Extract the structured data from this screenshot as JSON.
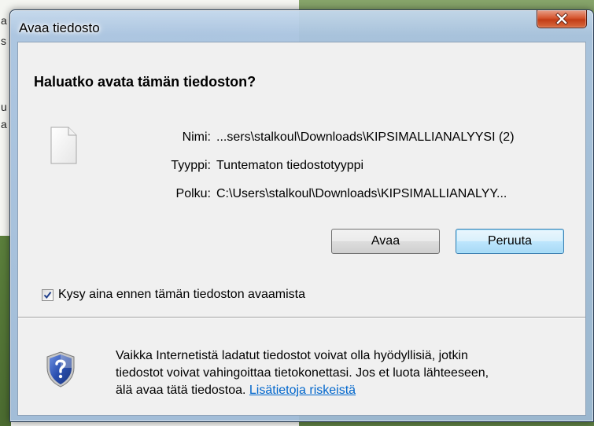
{
  "background": {
    "letters": [
      "a",
      "s",
      "u",
      "a"
    ]
  },
  "dialog": {
    "title": "Avaa tiedosto",
    "close_icon": "close-icon",
    "question": "Haluatko avata tämän tiedoston?",
    "file_icon": "blank-file-icon",
    "fields": [
      {
        "label": "Nimi:",
        "value": "...sers\\stalkoul\\Downloads\\KIPSIMALLIANALYYSI (2)"
      },
      {
        "label": "Tyyppi:",
        "value": "Tuntematon tiedostotyyppi"
      },
      {
        "label": "Polku:",
        "value": "C:\\Users\\stalkoul\\Downloads\\KIPSIMALLIANALYY..."
      }
    ],
    "buttons": {
      "open_label": "Avaa",
      "cancel_label": "Peruuta"
    },
    "checkbox": {
      "label": "Kysy aina ennen tämän tiedoston avaamista",
      "checked": true
    },
    "warning": {
      "icon": "shield-question-icon",
      "line1": "Vaikka Internetistä ladatut tiedostot voivat olla hyödyllisiä, jotkin",
      "line2": "tiedostot voivat vahingoittaa tietokonettasi. Jos et luota lähteeseen,",
      "line3_prefix": "älä avaa tätä tiedostoa. ",
      "link_text": "Lisätietoja riskeistä"
    }
  },
  "colors": {
    "link": "#0066cc",
    "close_button": "#c23d17",
    "default_button_border": "#3c7fb1",
    "shield_blue": "#2a4fb0"
  }
}
